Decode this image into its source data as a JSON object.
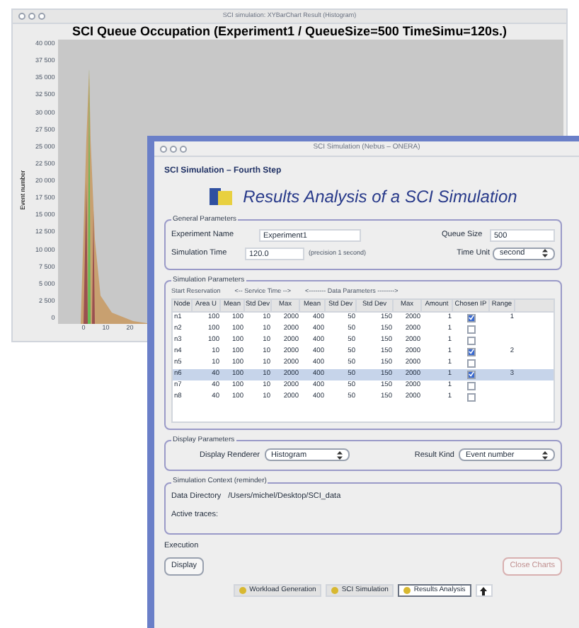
{
  "chart_window": {
    "title": "SCI simulation: XYBarChart Result (Histogram)",
    "chart": {
      "title": "SCI Queue Occupation (Experiment1 / QueueSize=500 TimeSimu=120s.)",
      "ylabel": "Event number",
      "yticks": [
        "40 000",
        "37 500",
        "35 000",
        "32 500",
        "30 000",
        "27 500",
        "25 000",
        "22 500",
        "20 000",
        "17 500",
        "15 000",
        "12 500",
        "10 000",
        "7 500",
        "5 000",
        "2 500",
        "0"
      ],
      "xticks": [
        "0",
        "10",
        "20"
      ]
    }
  },
  "main_window": {
    "title": "SCI Simulation (Nebus – ONERA)",
    "step": "SCI Simulation – Fourth Step",
    "heading": "Results Analysis of a SCI Simulation",
    "general": {
      "legend": "General Parameters",
      "experiment_name": {
        "label": "Experiment Name",
        "value": "Experiment1"
      },
      "queue_size": {
        "label": "Queue Size",
        "value": "500"
      },
      "simulation_time": {
        "label": "Simulation Time",
        "value": "120.0",
        "hint": "(precision 1 second)"
      },
      "time_unit": {
        "label": "Time Unit",
        "value": "second"
      }
    },
    "simulation": {
      "legend": "Simulation Parameters",
      "groups": [
        "Start Reservation",
        "<-- Service Time -->",
        "<-------- Data Parameters -------->"
      ],
      "columns": [
        "Node",
        "Area U",
        "Mean",
        "Std Dev",
        "Max",
        "Mean",
        "Std Dev",
        "Std Dev",
        "Max",
        "Amount",
        "Chosen IP",
        "Range"
      ],
      "rows": [
        {
          "cells": [
            "n1",
            "100",
            "100",
            "10",
            "2000",
            "400",
            "50",
            "150",
            "2000",
            "1"
          ],
          "chosen": true,
          "range": "1",
          "selected": false
        },
        {
          "cells": [
            "n2",
            "100",
            "100",
            "10",
            "2000",
            "400",
            "50",
            "150",
            "2000",
            "1"
          ],
          "chosen": false,
          "range": "",
          "selected": false
        },
        {
          "cells": [
            "n3",
            "100",
            "100",
            "10",
            "2000",
            "400",
            "50",
            "150",
            "2000",
            "1"
          ],
          "chosen": false,
          "range": "",
          "selected": false
        },
        {
          "cells": [
            "n4",
            "10",
            "100",
            "10",
            "2000",
            "400",
            "50",
            "150",
            "2000",
            "1"
          ],
          "chosen": true,
          "range": "2",
          "selected": false
        },
        {
          "cells": [
            "n5",
            "10",
            "100",
            "10",
            "2000",
            "400",
            "50",
            "150",
            "2000",
            "1"
          ],
          "chosen": false,
          "range": "",
          "selected": false
        },
        {
          "cells": [
            "n6",
            "40",
            "100",
            "10",
            "2000",
            "400",
            "50",
            "150",
            "2000",
            "1"
          ],
          "chosen": true,
          "range": "3",
          "selected": true
        },
        {
          "cells": [
            "n7",
            "40",
            "100",
            "10",
            "2000",
            "400",
            "50",
            "150",
            "2000",
            "1"
          ],
          "chosen": false,
          "range": "",
          "selected": false
        },
        {
          "cells": [
            "n8",
            "40",
            "100",
            "10",
            "2000",
            "400",
            "50",
            "150",
            "2000",
            "1"
          ],
          "chosen": false,
          "range": "",
          "selected": false
        }
      ]
    },
    "display": {
      "legend": "Display Parameters",
      "renderer": {
        "label": "Display Renderer",
        "value": "Histogram"
      },
      "result_kind": {
        "label": "Result Kind",
        "value": "Event number"
      }
    },
    "context": {
      "legend": "Simulation Context (reminder)",
      "data_directory": {
        "label": "Data Directory",
        "value": "/Users/michel/Desktop/SCI_data"
      },
      "active_traces": {
        "label": "Active traces:"
      }
    },
    "execution": {
      "label": "Execution",
      "buttons": [
        {
          "label": "Display",
          "disabled": false
        },
        {
          "label": "Close Charts",
          "disabled": true
        }
      ]
    },
    "tabs": [
      {
        "label": "Workload Generation",
        "selected": false
      },
      {
        "label": "SCI Simulation",
        "selected": false
      },
      {
        "label": "Results Analysis",
        "selected": true
      }
    ]
  }
}
